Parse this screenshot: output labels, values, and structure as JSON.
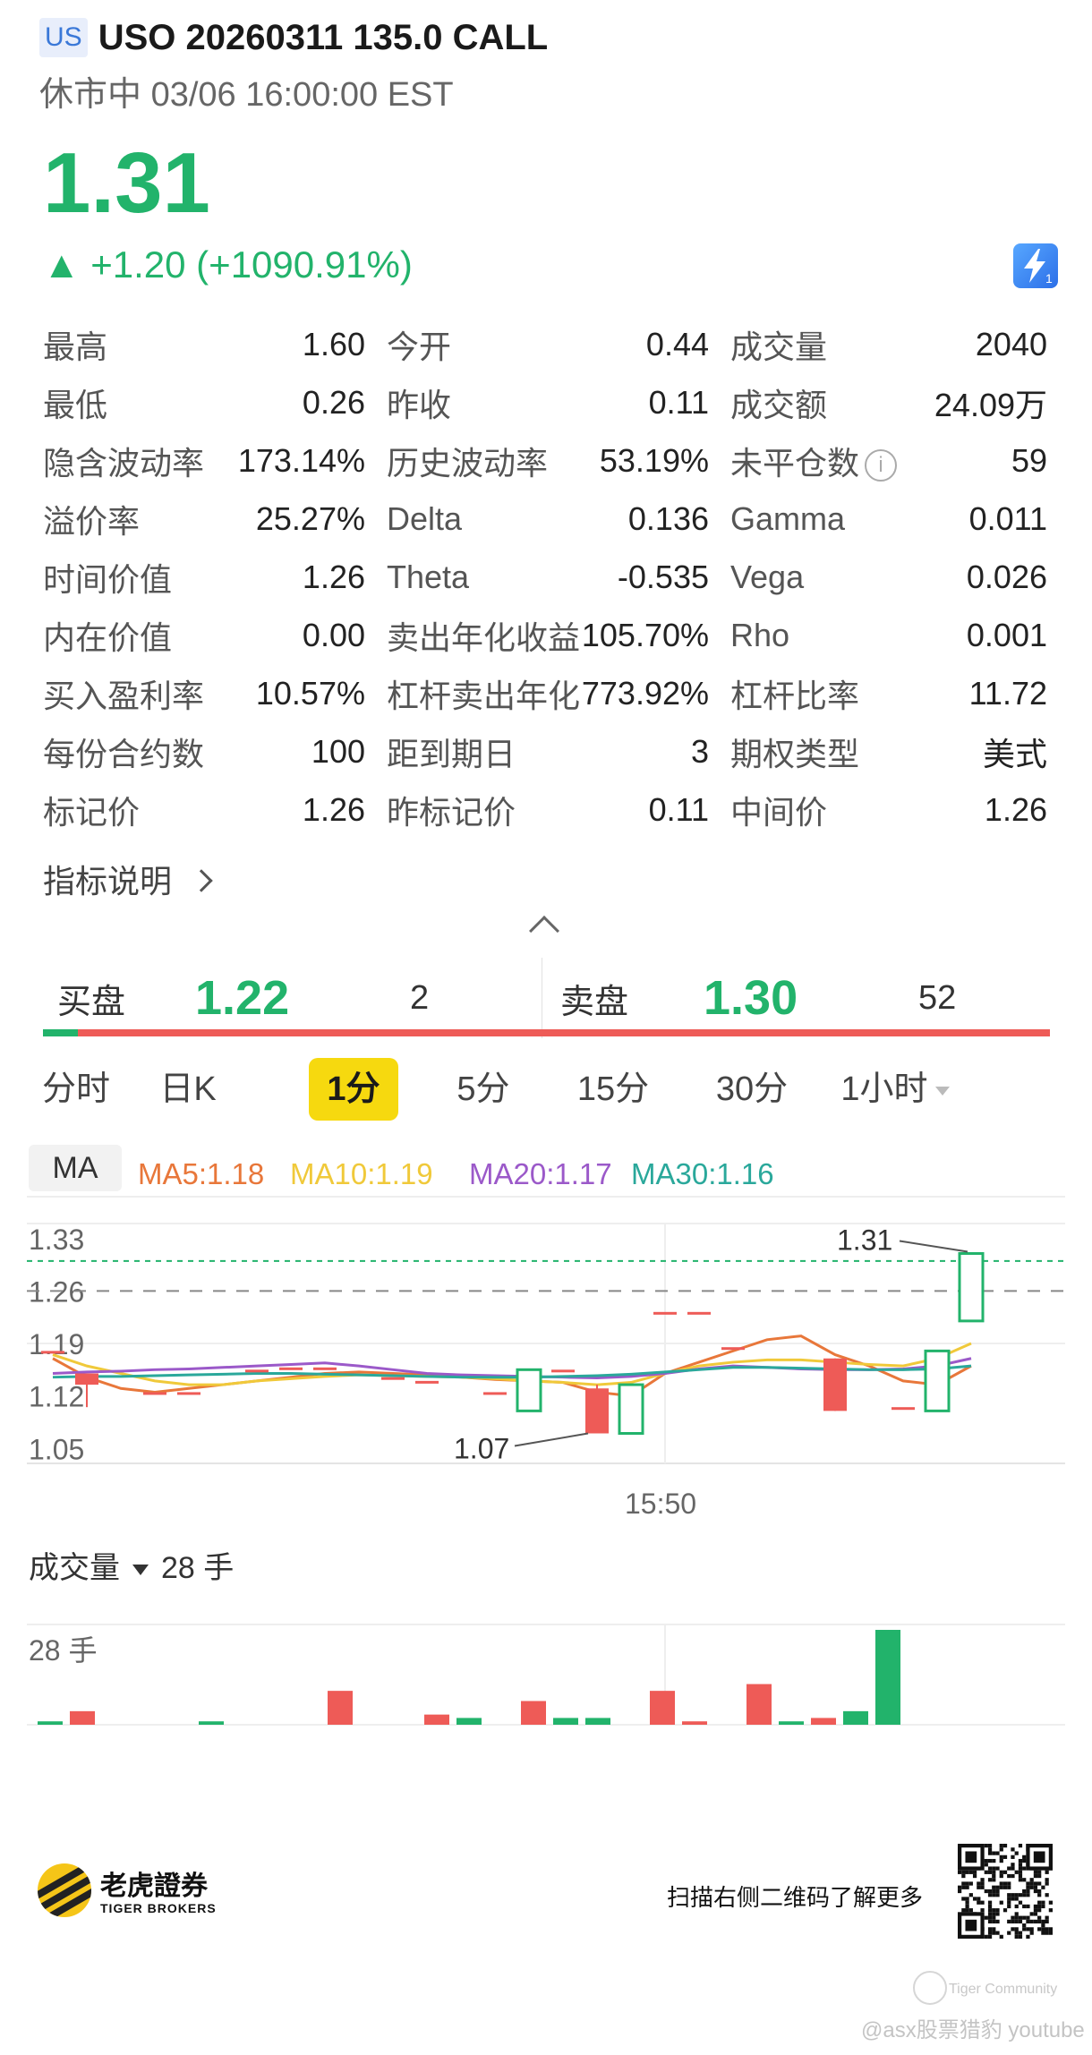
{
  "header": {
    "market_badge": "US",
    "title": "USO 20260311 135.0 CALL",
    "status": "休市中",
    "datetime": "03/06 16:00:00 EST"
  },
  "quote": {
    "price": "1.31",
    "change": "▲ +1.20 (+1090.91%)"
  },
  "stats": [
    [
      {
        "label": "最高",
        "value": "1.60"
      },
      {
        "label": "今开",
        "value": "0.44"
      },
      {
        "label": "成交量",
        "value": "2040"
      }
    ],
    [
      {
        "label": "最低",
        "value": "0.26"
      },
      {
        "label": "昨收",
        "value": "0.11"
      },
      {
        "label": "成交额",
        "value": "24.09万"
      }
    ],
    [
      {
        "label": "隐含波动率",
        "value": "173.14%"
      },
      {
        "label": "历史波动率",
        "value": "53.19%"
      },
      {
        "label": "未平仓数",
        "value": "59"
      }
    ],
    [
      {
        "label": "溢价率",
        "value": "25.27%"
      },
      {
        "label": "Delta",
        "value": "0.136"
      },
      {
        "label": "Gamma",
        "value": "0.011"
      }
    ],
    [
      {
        "label": "时间价值",
        "value": "1.26"
      },
      {
        "label": "Theta",
        "value": "-0.535"
      },
      {
        "label": "Vega",
        "value": "0.026"
      }
    ],
    [
      {
        "label": "内在价值",
        "value": "0.00"
      },
      {
        "label": "卖出年化收益",
        "value": "105.70%"
      },
      {
        "label": "Rho",
        "value": "0.001"
      }
    ],
    [
      {
        "label": "买入盈利率",
        "value": "10.57%"
      },
      {
        "label": "杠杆卖出年化",
        "value": "773.92%"
      },
      {
        "label": "杠杆比率",
        "value": "11.72"
      }
    ],
    [
      {
        "label": "每份合约数",
        "value": "100"
      },
      {
        "label": "距到期日",
        "value": "3"
      },
      {
        "label": "期权类型",
        "value": "美式"
      }
    ],
    [
      {
        "label": "标记价",
        "value": "1.26"
      },
      {
        "label": "昨标记价",
        "value": "0.11"
      },
      {
        "label": "中间价",
        "value": "1.26"
      }
    ]
  ],
  "indicator_link": "指标说明",
  "orderbook": {
    "bid_label": "买盘",
    "bid_price": "1.22",
    "bid_size": "2",
    "ask_label": "卖盘",
    "ask_price": "1.30",
    "ask_size": "52",
    "bid_ratio": 0.035
  },
  "tabs": [
    "分时",
    "日K",
    "1分",
    "5分",
    "15分",
    "30分",
    "1小时"
  ],
  "active_tab": "1分",
  "chart_data": {
    "type": "candlestick",
    "ma_label": "MA",
    "ma_legend": [
      {
        "name": "MA5",
        "value": "1.18",
        "color": "#e8773a",
        "text": "MA5:1.18"
      },
      {
        "name": "MA10",
        "value": "1.19",
        "color": "#f0c93a",
        "text": "MA10:1.19"
      },
      {
        "name": "MA20",
        "value": "1.17",
        "color": "#9b59c9",
        "text": "MA20:1.17"
      },
      {
        "name": "MA30",
        "value": "1.16",
        "color": "#2aa89b",
        "text": "MA30:1.16"
      }
    ],
    "y_ticks": [
      "1.33",
      "1.26",
      "1.19",
      "1.12",
      "1.05"
    ],
    "y_tick_values": [
      1.33,
      1.26,
      1.19,
      1.12,
      1.05
    ],
    "ylim": [
      1.03,
      1.35
    ],
    "x_tick": "15:50",
    "x_tick_index": 18,
    "n_slots": 28,
    "last_price_line": 1.3,
    "prev_close_line": 1.26,
    "high_annotation": {
      "text": "1.31",
      "value": 1.31,
      "index": 27
    },
    "low_annotation": {
      "text": "1.07",
      "value": 1.07,
      "index": 16
    },
    "candles": [
      {
        "i": 0,
        "o": 1.18,
        "h": 1.18,
        "l": 1.18,
        "c": 1.18,
        "dir": "flat"
      },
      {
        "i": 1,
        "o": 1.15,
        "h": 1.15,
        "l": 1.105,
        "c": 1.135,
        "dir": "down"
      },
      {
        "i": 3,
        "o": 1.125,
        "h": 1.125,
        "l": 1.125,
        "c": 1.125,
        "dir": "flat"
      },
      {
        "i": 4,
        "o": 1.125,
        "h": 1.125,
        "l": 1.125,
        "c": 1.125,
        "dir": "flat"
      },
      {
        "i": 6,
        "o": 1.155,
        "h": 1.155,
        "l": 1.155,
        "c": 1.155,
        "dir": "flat"
      },
      {
        "i": 7,
        "o": 1.158,
        "h": 1.158,
        "l": 1.158,
        "c": 1.158,
        "dir": "flat"
      },
      {
        "i": 8,
        "o": 1.158,
        "h": 1.158,
        "l": 1.158,
        "c": 1.158,
        "dir": "flat"
      },
      {
        "i": 10,
        "o": 1.145,
        "h": 1.145,
        "l": 1.145,
        "c": 1.145,
        "dir": "flat"
      },
      {
        "i": 11,
        "o": 1.14,
        "h": 1.14,
        "l": 1.14,
        "c": 1.14,
        "dir": "flat"
      },
      {
        "i": 13,
        "o": 1.125,
        "h": 1.125,
        "l": 1.125,
        "c": 1.125,
        "dir": "flat"
      },
      {
        "i": 14,
        "o": 1.1,
        "h": 1.155,
        "l": 1.1,
        "c": 1.155,
        "dir": "up"
      },
      {
        "i": 15,
        "o": 1.155,
        "h": 1.155,
        "l": 1.155,
        "c": 1.155,
        "dir": "flat"
      },
      {
        "i": 16,
        "o": 1.13,
        "h": 1.135,
        "l": 1.07,
        "c": 1.07,
        "dir": "down"
      },
      {
        "i": 17,
        "o": 1.07,
        "h": 1.135,
        "l": 1.07,
        "c": 1.135,
        "dir": "up"
      },
      {
        "i": 18,
        "o": 1.232,
        "h": 1.232,
        "l": 1.232,
        "c": 1.232,
        "dir": "flat"
      },
      {
        "i": 19,
        "o": 1.232,
        "h": 1.232,
        "l": 1.232,
        "c": 1.232,
        "dir": "flat"
      },
      {
        "i": 20,
        "o": 1.185,
        "h": 1.185,
        "l": 1.185,
        "c": 1.185,
        "dir": "flat"
      },
      {
        "i": 23,
        "o": 1.17,
        "h": 1.17,
        "l": 1.1,
        "c": 1.1,
        "dir": "down"
      },
      {
        "i": 25,
        "o": 1.105,
        "h": 1.105,
        "l": 1.105,
        "c": 1.105,
        "dir": "flat"
      },
      {
        "i": 26,
        "o": 1.1,
        "h": 1.18,
        "l": 1.1,
        "c": 1.18,
        "dir": "up"
      },
      {
        "i": 27,
        "o": 1.22,
        "h": 1.31,
        "l": 1.22,
        "c": 1.31,
        "dir": "up"
      }
    ],
    "ma_lines": {
      "MA5": [
        1.17,
        1.145,
        1.13,
        1.125,
        1.13,
        1.135,
        1.14,
        1.145,
        1.15,
        1.152,
        1.15,
        1.148,
        1.145,
        1.142,
        1.14,
        1.138,
        1.125,
        1.12,
        1.15,
        1.165,
        1.18,
        1.195,
        1.2,
        1.175,
        1.16,
        1.14,
        1.135,
        1.16
      ],
      "MA10": [
        1.175,
        1.16,
        1.15,
        1.14,
        1.135,
        1.135,
        1.14,
        1.143,
        1.146,
        1.148,
        1.147,
        1.146,
        1.145,
        1.143,
        1.14,
        1.138,
        1.135,
        1.138,
        1.15,
        1.16,
        1.165,
        1.168,
        1.168,
        1.165,
        1.162,
        1.16,
        1.17,
        1.19
      ],
      "MA20": [
        1.15,
        1.152,
        1.153,
        1.155,
        1.156,
        1.158,
        1.16,
        1.162,
        1.164,
        1.16,
        1.155,
        1.15,
        1.148,
        1.147,
        1.146,
        1.145,
        1.144,
        1.146,
        1.15,
        1.156,
        1.16,
        1.158,
        1.156,
        1.155,
        1.155,
        1.156,
        1.16,
        1.17
      ],
      "MA30": [
        1.145,
        1.146,
        1.146,
        1.147,
        1.148,
        1.149,
        1.15,
        1.15,
        1.149,
        1.148,
        1.147,
        1.146,
        1.145,
        1.145,
        1.145,
        1.146,
        1.147,
        1.149,
        1.152,
        1.155,
        1.158,
        1.158,
        1.157,
        1.156,
        1.155,
        1.155,
        1.156,
        1.16
      ]
    }
  },
  "volume": {
    "label": "成交量",
    "unit_value": "28 手",
    "max_label": "28 手",
    "max": 28,
    "bars": [
      {
        "i": 0,
        "v": 1,
        "dir": "up"
      },
      {
        "i": 1,
        "v": 4,
        "dir": "down"
      },
      {
        "i": 5,
        "v": 1,
        "dir": "up"
      },
      {
        "i": 9,
        "v": 10,
        "dir": "down"
      },
      {
        "i": 12,
        "v": 3,
        "dir": "down"
      },
      {
        "i": 13,
        "v": 2,
        "dir": "up"
      },
      {
        "i": 15,
        "v": 7,
        "dir": "down"
      },
      {
        "i": 16,
        "v": 2,
        "dir": "up"
      },
      {
        "i": 17,
        "v": 2,
        "dir": "up"
      },
      {
        "i": 19,
        "v": 10,
        "dir": "down"
      },
      {
        "i": 20,
        "v": 1,
        "dir": "down"
      },
      {
        "i": 22,
        "v": 12,
        "dir": "down"
      },
      {
        "i": 23,
        "v": 1,
        "dir": "up"
      },
      {
        "i": 24,
        "v": 2,
        "dir": "down"
      },
      {
        "i": 25,
        "v": 4,
        "dir": "up"
      },
      {
        "i": 26,
        "v": 28,
        "dir": "up"
      }
    ]
  },
  "footer": {
    "logo_cn": "老虎證券",
    "logo_en": "TIGER BROKERS",
    "scan_text": "扫描右侧二维码了解更多"
  },
  "watermark": {
    "community": "Tiger Community",
    "credit": "@asx股票猎豹 youtube"
  },
  "colors": {
    "up": "#22b36b",
    "down": "#ee5b57",
    "accent": "#f6d90f"
  }
}
